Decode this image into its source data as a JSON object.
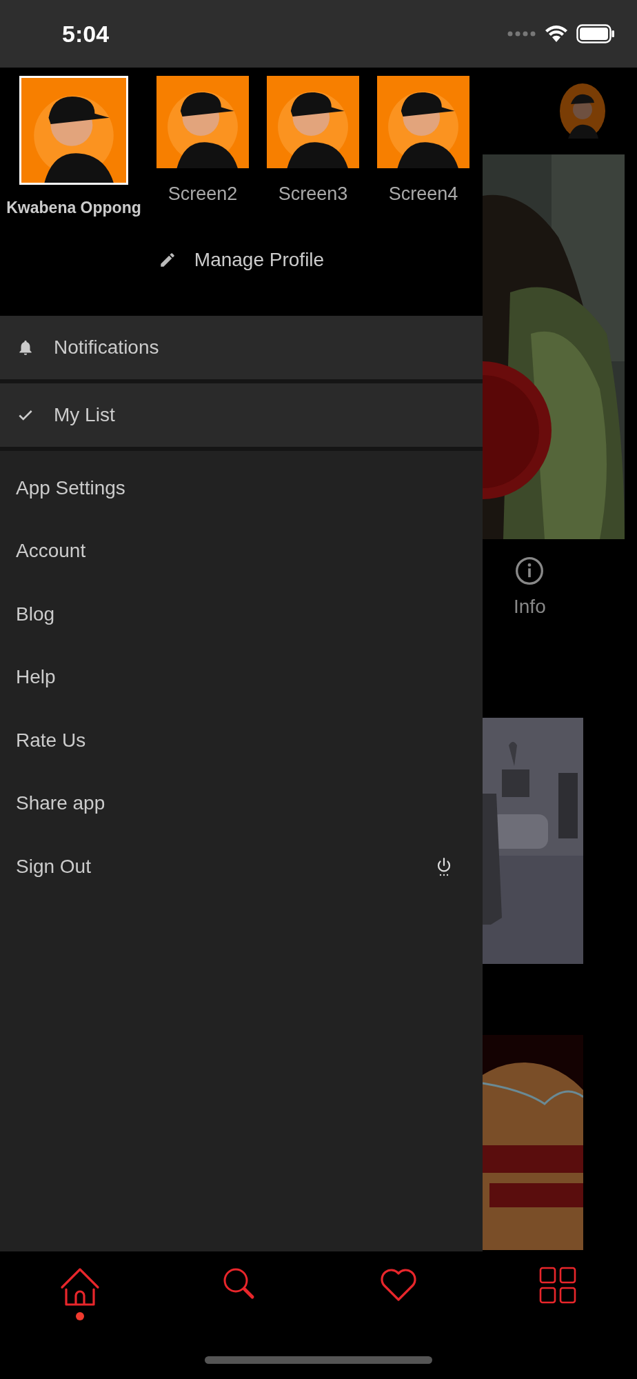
{
  "status_bar": {
    "time": "5:04"
  },
  "profiles": [
    {
      "name": "Kwabena Oppong",
      "selected": true
    },
    {
      "name": "Screen2",
      "selected": false
    },
    {
      "name": "Screen3",
      "selected": false
    },
    {
      "name": "Screen4",
      "selected": false
    }
  ],
  "manage_profile": {
    "label": "Manage Profile"
  },
  "notifications": {
    "label": "Notifications"
  },
  "my_list": {
    "label": "My List"
  },
  "menu": [
    "App Settings",
    "Account",
    "Blog",
    "Help",
    "Rate Us",
    "Share app"
  ],
  "sign_out": {
    "label": "Sign Out"
  },
  "info_button": {
    "label": "Info"
  },
  "bottom_nav": [
    {
      "selected": true
    },
    {
      "selected": false
    },
    {
      "selected": false
    },
    {
      "selected": false
    }
  ]
}
